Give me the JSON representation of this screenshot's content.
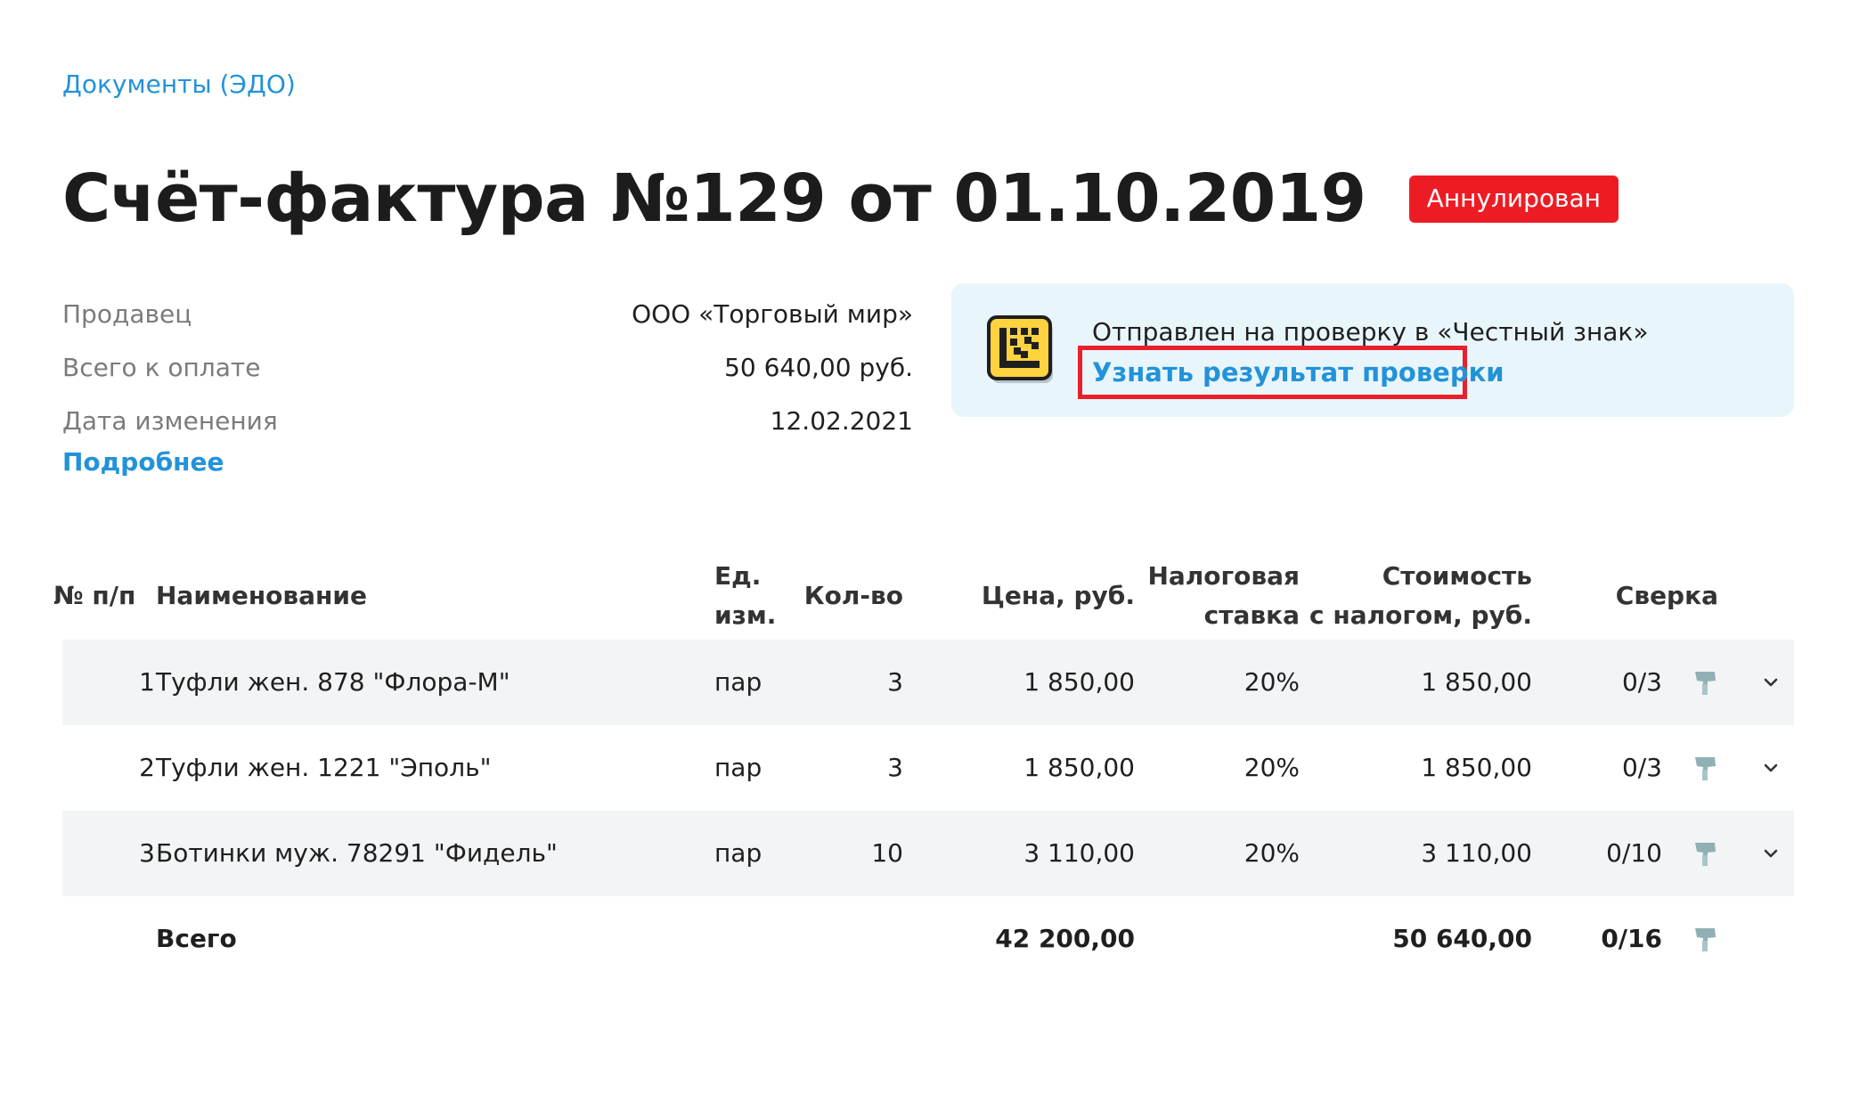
{
  "breadcrumb": {
    "label": "Документы (ЭДО)"
  },
  "header": {
    "title": "Счёт-фактура №129 от 01.10.2019",
    "status": "Аннулирован",
    "status_color": "#ed1c24"
  },
  "info": {
    "seller_label": "Продавец",
    "seller_value": "ООО «Торговый мир»",
    "total_label": "Всего к оплате",
    "total_value": "50 640,00 руб.",
    "date_label": "Дата изменения",
    "date_value": "12.02.2021",
    "more_link": "Подробнее"
  },
  "notice": {
    "icon": "datamatrix-icon",
    "text": "Отправлен на проверку в «Честный знак»",
    "link": "Узнать результат проверки"
  },
  "table": {
    "headers": {
      "num": "№ п/п",
      "name": "Наименование",
      "unit_1": "Ед.",
      "unit_2": "изм.",
      "qty": "Кол-во",
      "price": "Цена, руб.",
      "tax_1": "Налоговая",
      "tax_2": "ставка",
      "cost_1": "Стоимость",
      "cost_2": "с налогом, руб.",
      "check": "Сверка"
    },
    "rows": [
      {
        "num": "1",
        "name": "Туфли жен. 878 \"Флора-М\"",
        "unit": "пар",
        "qty": "3",
        "price": "1 850,00",
        "tax": "20%",
        "cost": "1 850,00",
        "check": "0/3"
      },
      {
        "num": "2",
        "name": "Туфли жен. 1221 \"Эполь\"",
        "unit": "пар",
        "qty": "3",
        "price": "1 850,00",
        "tax": "20%",
        "cost": "1 850,00",
        "check": "0/3"
      },
      {
        "num": "3",
        "name": "Ботинки муж. 78291 \"Фидель\"",
        "unit": "пар",
        "qty": "10",
        "price": "3 110,00",
        "tax": "20%",
        "cost": "3 110,00",
        "check": "0/10"
      }
    ],
    "total": {
      "label": "Всего",
      "price": "42 200,00",
      "cost": "50 640,00",
      "check": "0/16"
    }
  },
  "colors": {
    "link": "#2392d9",
    "notice_bg": "#e8f6fc",
    "highlight_border": "#e8202b",
    "row_shade": "#f3f4f6"
  }
}
